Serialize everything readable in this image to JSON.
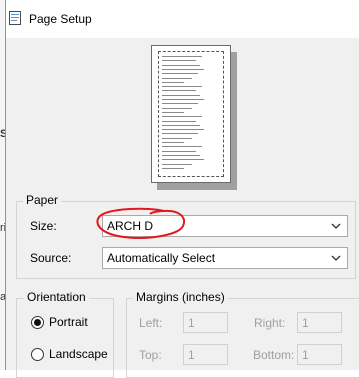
{
  "window": {
    "title": "Page Setup"
  },
  "background_app": {
    "glyphs": [
      "S",
      "ri",
      "a"
    ]
  },
  "paper": {
    "group_label": "Paper",
    "size_label": "Size:",
    "size_value": "ARCH D",
    "source_label": "Source:",
    "source_value": "Automatically Select"
  },
  "orientation": {
    "group_label": "Orientation",
    "portrait_label": "Portrait",
    "landscape_label": "Landscape",
    "selected": "Portrait"
  },
  "margins": {
    "group_label": "Margins (inches)",
    "left_label": "Left:",
    "left_value": "1",
    "right_label": "Right:",
    "right_value": "1",
    "top_label": "Top:",
    "top_value": "1",
    "bottom_label": "Bottom:",
    "bottom_value": "1"
  },
  "colors": {
    "annotation_circle": "#e3171c",
    "dialog_bg": "#f0f0f0"
  }
}
